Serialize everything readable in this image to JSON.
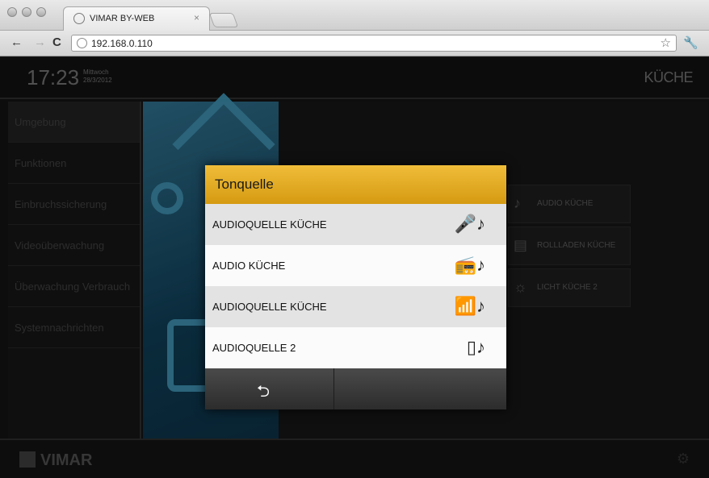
{
  "browser": {
    "tab_title": "VIMAR BY-WEB",
    "tab_close": "×",
    "url": "192.168.0.110",
    "back": "←",
    "forward": "→",
    "reload": "C",
    "star": "☆",
    "wrench": "🔧"
  },
  "header": {
    "time": "17:23",
    "weekday": "Mittwoch",
    "date": "28/3/2012",
    "room": "KÜCHE"
  },
  "sidebar": {
    "items": [
      {
        "label": "Umgebung"
      },
      {
        "label": "Funktionen"
      },
      {
        "label": "Einbruchssicherung"
      },
      {
        "label": "Videoüberwachung"
      },
      {
        "label": "Überwachung Verbrauch"
      },
      {
        "label": "Systemnachrichten"
      }
    ]
  },
  "tiles": [
    {
      "label": "AUDIO KÜCHE",
      "icon": "♪"
    },
    {
      "label": "ROLLLADEN KÜCHE",
      "icon": "▤"
    },
    {
      "label": "LICHT KÜCHE 2",
      "icon": "☼"
    }
  ],
  "footer": {
    "brand": "VIMAR",
    "gear": "⚙"
  },
  "dialog": {
    "title": "Tonquelle",
    "rows": [
      {
        "label": "AUDIOQUELLE KÜCHE",
        "icon": "🎤♪"
      },
      {
        "label": "AUDIO KÜCHE",
        "icon": "📻♪"
      },
      {
        "label": "AUDIOQUELLE KÜCHE",
        "icon": "📶♪"
      },
      {
        "label": "AUDIOQUELLE 2",
        "icon": "▯♪"
      }
    ],
    "back": "⮌"
  }
}
